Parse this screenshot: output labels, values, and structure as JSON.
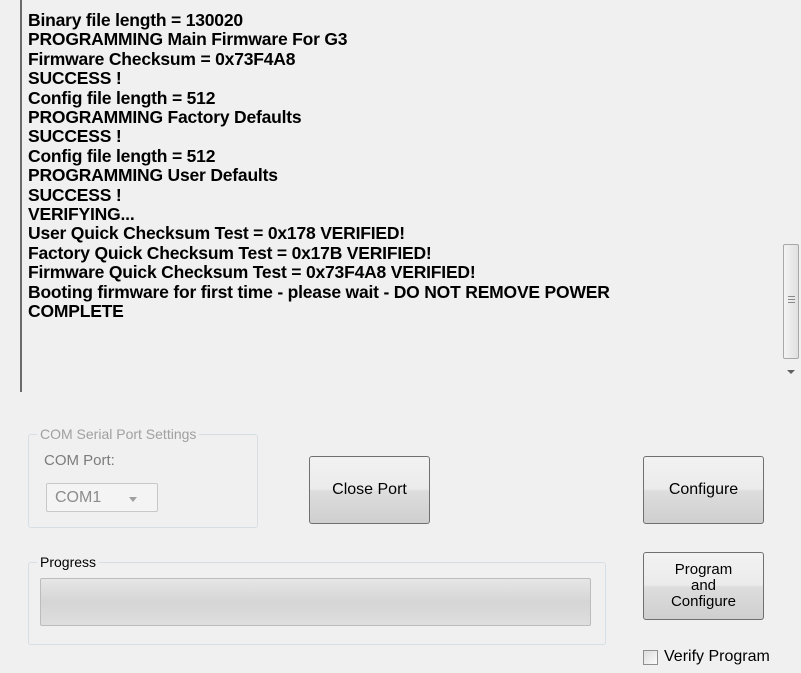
{
  "log": {
    "lines": [
      "Binary file length = 130020",
      "PROGRAMMING Main Firmware For G3",
      "Firmware Checksum = 0x73F4A8",
      "SUCCESS !",
      "Config file length = 512",
      "PROGRAMMING Factory Defaults",
      "SUCCESS !",
      "Config file length = 512",
      "PROGRAMMING User Defaults",
      "SUCCESS !",
      "VERIFYING...",
      "User Quick Checksum Test = 0x178 VERIFIED!",
      "Factory Quick Checksum Test = 0x17B VERIFIED!",
      "Firmware Quick Checksum Test = 0x73F4A8 VERIFIED!",
      "Booting firmware for first time - please wait - DO NOT REMOVE POWER",
      "COMPLETE"
    ]
  },
  "com_group": {
    "title": "COM Serial Port Settings",
    "port_label": "COM Port:",
    "port_value": "COM1"
  },
  "buttons": {
    "close_port": "Close Port",
    "configure": "Configure",
    "program_line1": "Program",
    "program_line2": "and",
    "program_line3": "Configure"
  },
  "progress_group": {
    "title": "Progress",
    "value_percent": 0
  },
  "verify": {
    "label": "Verify Program",
    "checked": false
  }
}
